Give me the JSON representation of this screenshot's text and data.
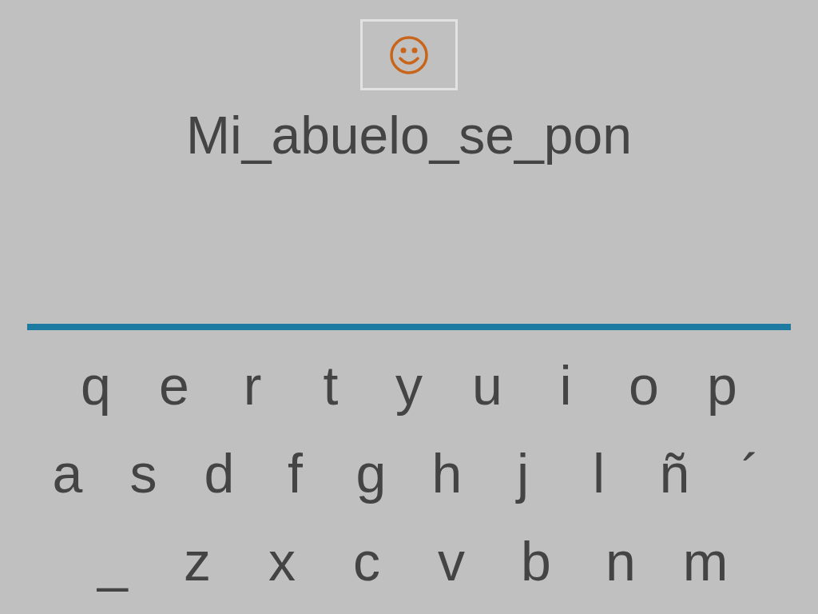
{
  "phrase": "Mi_abuelo_se_pon",
  "keyboard": {
    "rows": [
      [
        "q",
        "e",
        "r",
        "t",
        "y",
        "u",
        "i",
        "o",
        "p"
      ],
      [
        "a",
        "s",
        "d",
        "f",
        "g",
        "h",
        "j",
        "l",
        "ñ",
        "´"
      ],
      [
        "_",
        "z",
        "x",
        "c",
        "v",
        "b",
        "n",
        "m"
      ]
    ]
  }
}
